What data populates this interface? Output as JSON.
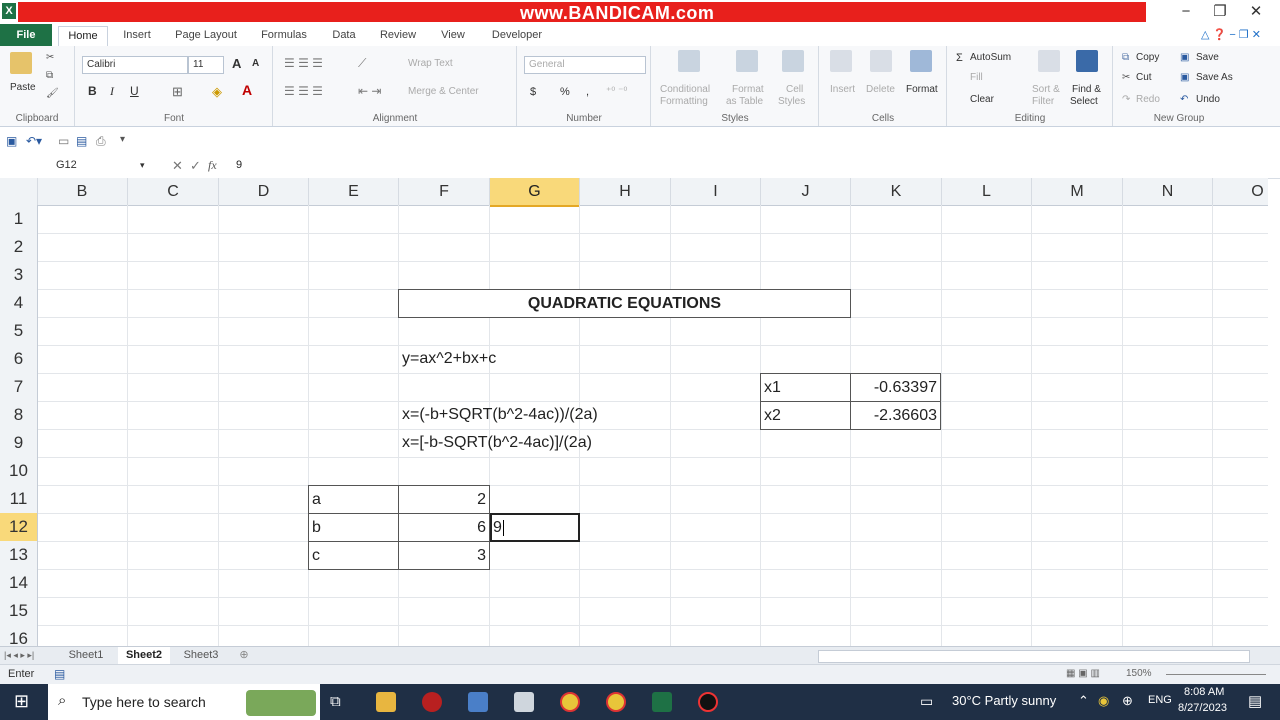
{
  "title_bar": {
    "watermark": "www.BANDICAM.com",
    "minimize": "−",
    "restore": "❐",
    "close": "✕",
    "app_icon": "X"
  },
  "tabs": [
    {
      "label": "File"
    },
    {
      "label": "Home"
    },
    {
      "label": "Insert"
    },
    {
      "label": "Page Layout"
    },
    {
      "label": "Formulas"
    },
    {
      "label": "Data"
    },
    {
      "label": "Review"
    },
    {
      "label": "View"
    },
    {
      "label": "Developer"
    }
  ],
  "ribbon": {
    "clipboard": {
      "label": "Clipboard",
      "paste": "Paste"
    },
    "font": {
      "label": "Font",
      "name": "Calibri",
      "size": "11",
      "bold": "B",
      "italic": "I",
      "underline": "U",
      "grow": "A",
      "shrink": "A"
    },
    "alignment": {
      "label": "Alignment",
      "wrap": "Wrap Text",
      "merge": "Merge & Center"
    },
    "number": {
      "label": "Number",
      "format": "General",
      "currency": "$",
      "percent": "%",
      "comma": ","
    },
    "styles": {
      "label": "Styles",
      "conditional": "Conditional",
      "conditional2": "Formatting",
      "format_table": "Format",
      "format_table2": "as Table",
      "cell_styles": "Cell",
      "cell_styles2": "Styles"
    },
    "cells": {
      "label": "Cells",
      "insert": "Insert",
      "delete": "Delete",
      "format": "Format"
    },
    "editing": {
      "label": "Editing",
      "autosum": "AutoSum",
      "fill": "Fill",
      "clear": "Clear",
      "sort": "Sort &",
      "sort2": "Filter",
      "find": "Find &",
      "find2": "Select"
    },
    "new_group": {
      "label": "New Group",
      "copy": "Copy",
      "cut": "Cut",
      "redo": "Redo",
      "save": "Save",
      "save_as": "Save As",
      "undo": "Undo"
    }
  },
  "formula_bar": {
    "name_box": "G12",
    "value": "9"
  },
  "columns": [
    "B",
    "C",
    "D",
    "E",
    "F",
    "G",
    "H",
    "I",
    "J",
    "K",
    "L",
    "M",
    "N",
    "O"
  ],
  "selected_column": "G",
  "rows": [
    "1",
    "2",
    "3",
    "4",
    "5",
    "6",
    "7",
    "8",
    "9",
    "10",
    "11",
    "12",
    "13",
    "14",
    "15",
    "16"
  ],
  "selected_row": "12",
  "cells": {
    "title": "QUADRATIC EQUATIONS",
    "equation": "y=ax^2+bx+c",
    "formula1": "x=(-b+SQRT(b^2-4ac))/(2a)",
    "formula2": "x=[-b-SQRT(b^2-4ac)]/(2a)",
    "x1_label": "x1",
    "x1_value": "-0.63397",
    "x2_label": "x2",
    "x2_value": "-2.36603",
    "a_label": "a",
    "a_value": "2",
    "b_label": "b",
    "b_value": "6",
    "c_label": "c",
    "c_value": "3",
    "editing_value": "9"
  },
  "sheets": [
    "Sheet1",
    "Sheet2",
    "Sheet3"
  ],
  "active_sheet": "Sheet2",
  "status": {
    "mode": "Enter",
    "zoom": "150%"
  },
  "taskbar": {
    "search_placeholder": "Type here to search",
    "weather": "30°C  Partly sunny",
    "lang": "ENG",
    "time": "8:08 AM",
    "date": "8/27/2023"
  }
}
